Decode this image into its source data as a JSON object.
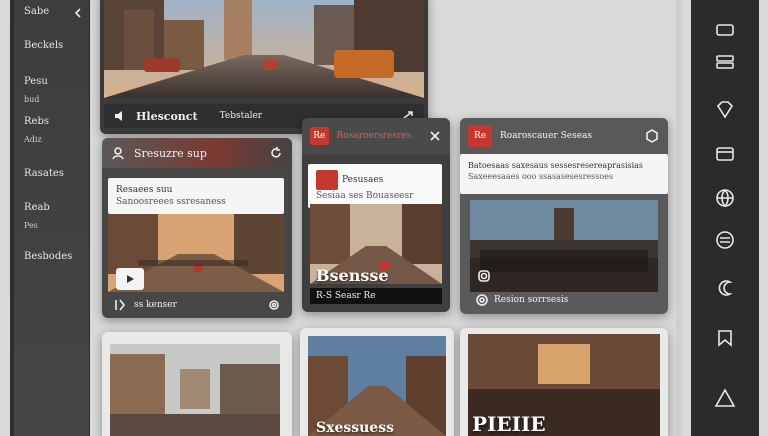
{
  "sidebar": {
    "items": [
      {
        "label": "Sabe"
      },
      {
        "label": "Beckels"
      },
      {
        "label": "Pesu",
        "sub": "bud"
      },
      {
        "label": "Rebs",
        "sub": "Adiz"
      },
      {
        "label": "Rasates"
      },
      {
        "label": "Reab",
        "sub": "Pes"
      },
      {
        "label": "Besbodes"
      }
    ]
  },
  "cards": {
    "top": {
      "caption": "Hlesconct",
      "caption2": "Tebstaler"
    },
    "left": {
      "title": "Sresuzre sup",
      "panel_line1": "Resaees suu",
      "panel_line2": "Sanoosreees ssresaness",
      "footer": "ss kenser"
    },
    "middle": {
      "badge": "Re",
      "title": "Rosaroersresres",
      "panel_line1": "Pesusaes",
      "panel_line2": "Sesiaa ses Bouaseesr",
      "photo_title": "Bsensse",
      "footer": "R-S Seasr Re"
    },
    "right": {
      "badge": "Re",
      "title": "Roaroscauer Seseas",
      "panel_line1": "Batoesaas saxesaus sessesresereaprasisias",
      "panel_line2": "Saxeeesaaes ooo ssasasesesressoes",
      "footer": "Resion sorrsesis"
    },
    "bottom_middle": {
      "photo_title": "Sxessuess"
    },
    "bottom_right": {
      "photo_title": "PIEIIE"
    }
  },
  "colors": {
    "accent_red": "#c4382f",
    "rail_bg": "#2b2b2b",
    "sidebar_bg": "#404040",
    "page_bg": "#d9d9d9"
  },
  "icons": {
    "rail": [
      "window-icon",
      "server-icon",
      "gem-icon",
      "card-icon",
      "globe-icon",
      "badge-icon",
      "moon-icon",
      "bookmark-icon",
      "warning-icon"
    ]
  }
}
